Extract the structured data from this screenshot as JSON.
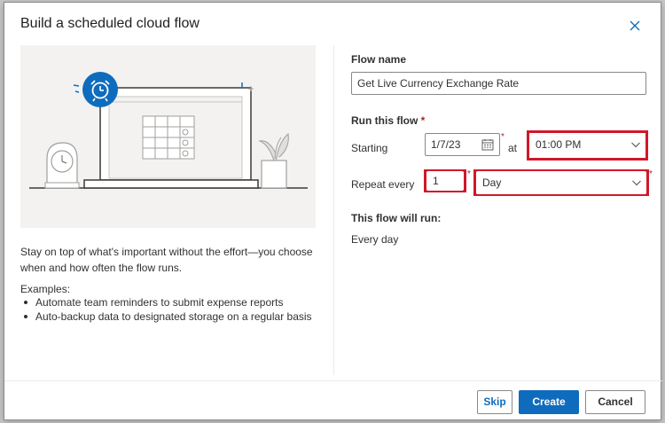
{
  "dialog": {
    "title": "Build a scheduled cloud flow",
    "close_icon": "close-icon"
  },
  "left": {
    "description": "Stay on top of what's important without the effort—you choose when and how often the flow runs.",
    "examples_title": "Examples:",
    "examples": [
      "Automate team reminders to submit expense reports",
      "Auto-backup data to designated storage on a regular basis"
    ]
  },
  "form": {
    "flow_name_label": "Flow name",
    "flow_name_value": "Get Live Currency Exchange Rate",
    "run_label": "Run this flow",
    "required_mark": "*",
    "starting_label": "Starting",
    "start_date": "1/7/23",
    "at_label": "at",
    "time_value": "01:00 PM",
    "repeat_label": "Repeat every",
    "repeat_count": "1",
    "repeat_unit": "Day",
    "summary_label": "This flow will run:",
    "summary_value": "Every day"
  },
  "footer": {
    "skip_label": "Skip",
    "create_label": "Create",
    "cancel_label": "Cancel"
  },
  "colors": {
    "accent": "#0f6cbd",
    "highlight": "#d0182a",
    "required": "#a4262c"
  }
}
